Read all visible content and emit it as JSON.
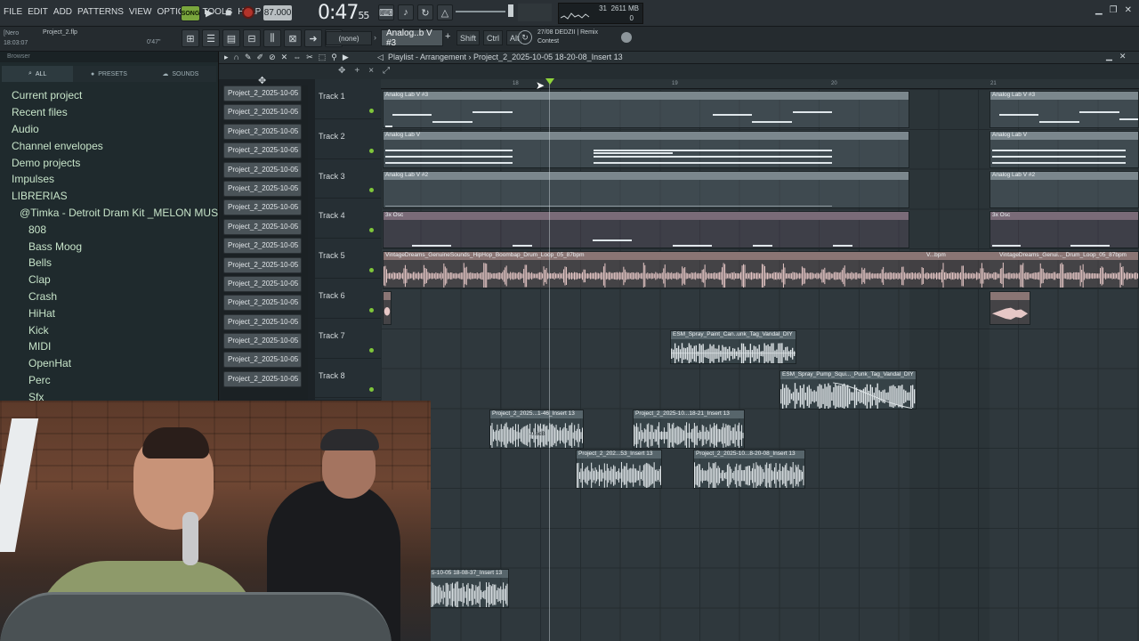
{
  "menu": [
    "FILE",
    "EDIT",
    "ADD",
    "PATTERNS",
    "VIEW",
    "OPTIONS",
    "TOOLS",
    "HELP"
  ],
  "transport": {
    "song_label": "SONG",
    "bpm": "87.000",
    "time_main": "0:47",
    "time_sub": "55"
  },
  "cpu": {
    "cpu": "31",
    "memory": "2611 MB",
    "polyphony": "0"
  },
  "hint": {
    "line1": "[Nero",
    "line2": "18:03:07",
    "project": "Project_2.flp",
    "duration": "0'47\""
  },
  "toolbar": {
    "none_select": "(none)",
    "pattern": "Analog..b V #3",
    "shift": "Shift",
    "ctrl": "Ctrl",
    "alt": "Alt"
  },
  "news": {
    "line1": "27/08  DEDZII | Remix",
    "line2": "Contest"
  },
  "browser": {
    "title": "Browser",
    "tabs": [
      "ALL",
      "PRESETS",
      "SOUNDS"
    ],
    "items": [
      {
        "label": "Current project",
        "level": 0
      },
      {
        "label": "Recent files",
        "level": 0
      },
      {
        "label": "Audio",
        "level": 0
      },
      {
        "label": "Channel envelopes",
        "level": 0
      },
      {
        "label": "Demo projects",
        "level": 0
      },
      {
        "label": "Impulses",
        "level": 0
      },
      {
        "label": "LIBRERIAS",
        "level": 0
      },
      {
        "label": "@Timka - Detroit Dram Kit _MELON MUSIC_",
        "level": 1
      },
      {
        "label": "808",
        "level": 2
      },
      {
        "label": "Bass Moog",
        "level": 2
      },
      {
        "label": "Bells",
        "level": 2
      },
      {
        "label": "Clap",
        "level": 2
      },
      {
        "label": "Crash",
        "level": 2
      },
      {
        "label": "HiHat",
        "level": 2
      },
      {
        "label": "Kick",
        "level": 2
      },
      {
        "label": "MIDI",
        "level": 2
      },
      {
        "label": "OpenHat",
        "level": 2
      },
      {
        "label": "Perc",
        "level": 2
      },
      {
        "label": "Sfx",
        "level": 2
      }
    ]
  },
  "patterns": [
    "Project_2_2025-10-05 1...",
    "Project_2_2025-10-05 1...",
    "Project_2_2025-10-05 1...",
    "Project_2_2025-10-05 1...",
    "Project_2_2025-10-05 1...",
    "Project_2_2025-10-05 1...",
    "Project_2_2025-10-05 1...",
    "Project_2_2025-10-05 1...",
    "Project_2_2025-10-05 1...",
    "Project_2_2025-10-05 1...",
    "Project_2_2025-10-05 1...",
    "Project_2_2025-10-05 1...",
    "Project_2_2025-10-05 1...",
    "Project_2_2025-10-05 1...",
    "Project_2_2025-10-05 1...",
    "Project_2_2025-10-05 1..."
  ],
  "playlist": {
    "title": "Playlist - Arrangement",
    "breadcrumb": "Project_2_2025-10-05 18-20-08_Insert 13",
    "ruler": [
      "18",
      "19",
      "20",
      "21"
    ],
    "tracks": [
      "Track 1",
      "Track 2",
      "Track 3",
      "Track 4",
      "Track 5",
      "Track 6",
      "Track 7",
      "Track 8"
    ]
  },
  "clips": {
    "c1a": "Analog Lab V #3",
    "c1b": "Analog Lab V #3",
    "c2a": "Analog Lab V",
    "c2b": "Analog Lab V",
    "c3a": "Analog Lab V #2",
    "c3b": "Analog Lab V #2",
    "c4a": "3x Osc",
    "c4b": "3x Osc",
    "c5a": "VintageDreams_GenuineSounds_HipHop_Boombap_Drum_Loop_05_87bpm",
    "c5m": "V...bpm",
    "c5b": "VintageDreams_Genui..._Drum_Loop_05_87bpm",
    "c7": "ESM_Spray_Paint_Can..unk_Tag_Vandal_DIY",
    "c8": "ESM_Spray_Pump_Squi..._Punk_Tag_Vandal_DIY",
    "a1": "Project_2_2025...1-46_Insert 13",
    "a1db": "-0.6dB",
    "a2": "Project_2_2025-10...18-21_Insert 13",
    "a3": "Project_2_202...53_Insert 13",
    "a4": "Project_2_2025-10...8-20-08_Insert 13",
    "a5": "5-10-05 18-08-37_Insert 13"
  }
}
